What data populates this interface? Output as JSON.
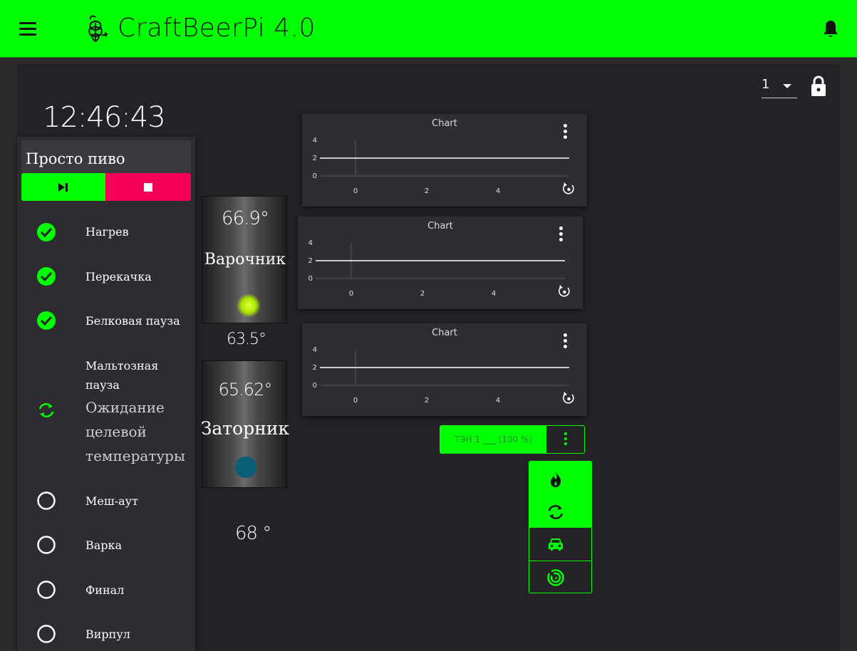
{
  "app": {
    "title": "CraftBeerPi 4.0"
  },
  "dashboard": {
    "page_value": "1",
    "clock": "12:46:43"
  },
  "steps": {
    "title": "Просто пиво",
    "items": [
      {
        "label": "Нагрев",
        "state": "done",
        "icon": "check-circle-icon"
      },
      {
        "label": "Перекачка",
        "state": "done",
        "icon": "check-circle-icon"
      },
      {
        "label": "Белковая пауза",
        "state": "done",
        "icon": "check-circle-icon"
      },
      {
        "label": "Мальтозная",
        "label2": "пауза",
        "status": [
          "Ожидание",
          "целевой",
          "температуры"
        ],
        "state": "active",
        "icon": "sync-icon"
      },
      {
        "label": "Меш-аут",
        "state": "pending",
        "icon": "circle-outline-icon"
      },
      {
        "label": "Варка",
        "state": "pending",
        "icon": "circle-outline-icon"
      },
      {
        "label": "Финал",
        "state": "pending",
        "icon": "circle-outline-icon"
      },
      {
        "label": "Вирпул",
        "state": "pending",
        "icon": "circle-outline-icon"
      }
    ]
  },
  "kettles": [
    {
      "name": "Варочник",
      "temp": "66.9°",
      "light_color": "#a8e600"
    },
    {
      "name": "Заторник",
      "temp": "65.62°",
      "light_color": "#0b5e78"
    }
  ],
  "sensors": {
    "value1": "63.5°",
    "value2": "68 °"
  },
  "actor": {
    "label": "ТЭН 1 ___ (100 %)"
  },
  "colors": {
    "accent": "#00ff00",
    "stop": "#f50057"
  },
  "chart_data": [
    {
      "type": "line",
      "title": "Chart",
      "x_ticks": [
        "0",
        "2",
        "4"
      ],
      "y_ticks": [
        "0",
        "2",
        "4"
      ],
      "xlim": [
        -1,
        6
      ],
      "ylim": [
        0,
        4
      ],
      "series": [
        {
          "x": [
            -1,
            6
          ],
          "y": [
            2,
            2
          ]
        }
      ]
    },
    {
      "type": "line",
      "title": "Chart",
      "x_ticks": [
        "0",
        "2",
        "4"
      ],
      "y_ticks": [
        "0",
        "2",
        "4"
      ],
      "xlim": [
        -1,
        6
      ],
      "ylim": [
        0,
        4
      ],
      "series": [
        {
          "x": [
            -1,
            6
          ],
          "y": [
            2,
            2
          ]
        }
      ]
    },
    {
      "type": "line",
      "title": "Chart",
      "x_ticks": [
        "0",
        "2",
        "4"
      ],
      "y_ticks": [
        "0",
        "2",
        "4"
      ],
      "xlim": [
        -1,
        6
      ],
      "ylim": [
        0,
        4
      ],
      "series": [
        {
          "x": [
            -1,
            6
          ],
          "y": [
            2,
            2
          ]
        }
      ]
    }
  ]
}
